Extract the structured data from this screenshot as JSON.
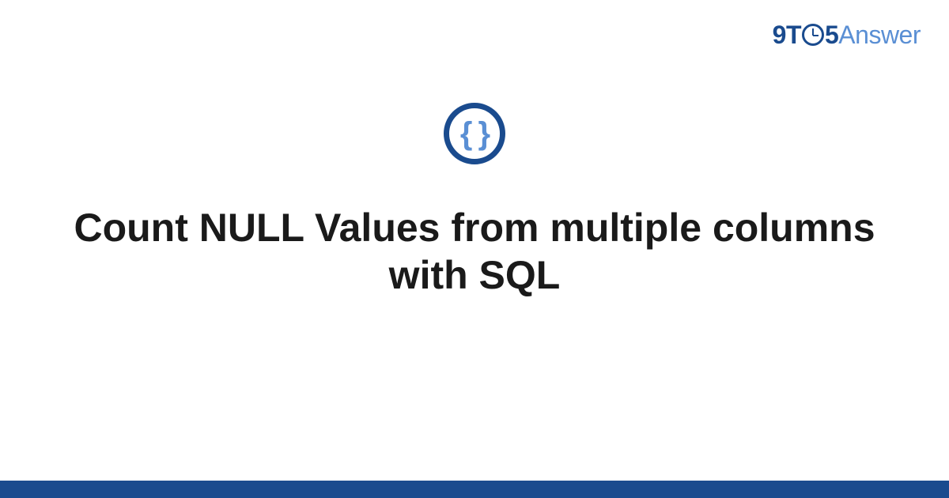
{
  "logo": {
    "prefix": "9T",
    "middle": "5",
    "suffix": "Answer"
  },
  "icon": {
    "symbol": "{ }",
    "name": "code-braces"
  },
  "title": "Count NULL Values from multiple columns with SQL",
  "colors": {
    "primary": "#1a4b8e",
    "accent": "#5a8fd4"
  }
}
